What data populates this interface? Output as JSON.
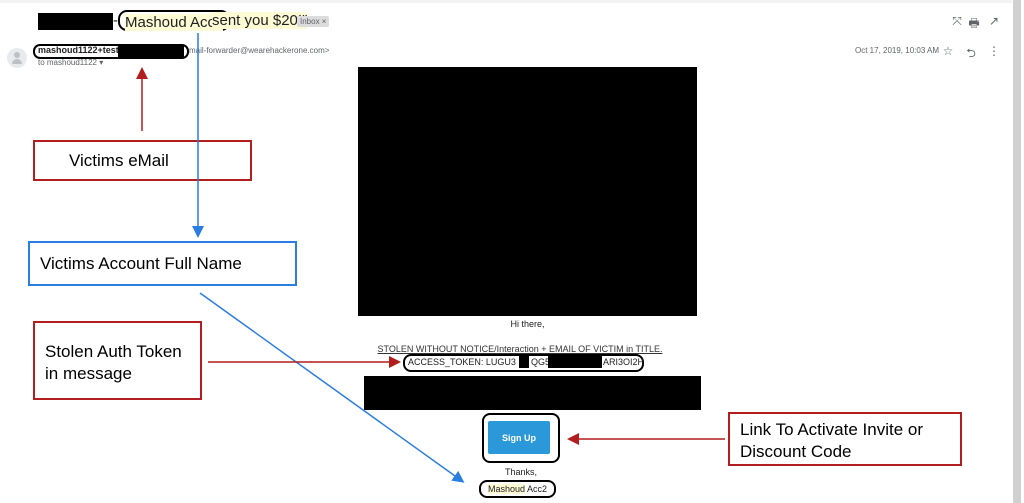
{
  "email": {
    "subject": {
      "name": "Mashoud Acc2",
      "rest": "sent you $20!\"",
      "dash": "-",
      "label_chip": "Inbox ×"
    },
    "sender": {
      "name": "mashoud1122+test@",
      "address": "mail-forwarder@wearehackerone.com>",
      "to_line": "to mashoud1122 ▾"
    },
    "date": "Oct 17, 2019, 10:03 AM",
    "toolbar_icons": {
      "collapse": "⤧",
      "print": "🖶",
      "open_new_window": "↗",
      "star": "☆",
      "reply": "⮌",
      "more": "⋮"
    },
    "body": {
      "greeting": "Hi there,",
      "stolen_line": "STOLEN WITHOUT NOTICE/Interaction + EMAIL OF VICTIM in TITLE.",
      "token_prefix": "ACCESS_TOKEN: LUGU3",
      "token_mid": "QG5",
      "token_tail": "ARI3OI2H",
      "signup_label": "Sign Up",
      "thanks": "Thanks,",
      "signature_first": "Mashoud",
      "signature_last": " Acc2"
    }
  },
  "annotations": {
    "victims_email": "Victims eMail",
    "victims_full_name": "Victims Account Full Name",
    "stolen_token_line1": "Stolen Auth Token",
    "stolen_token_line2": "in message",
    "link_line1": "Link To Activate Invite or",
    "link_line2": "Discount Code"
  },
  "colors": {
    "annotation_red": "#b21d1d",
    "annotation_blue": "#2a7de1",
    "button_blue": "#2a98d9",
    "highlight": "#fdfbd4"
  }
}
